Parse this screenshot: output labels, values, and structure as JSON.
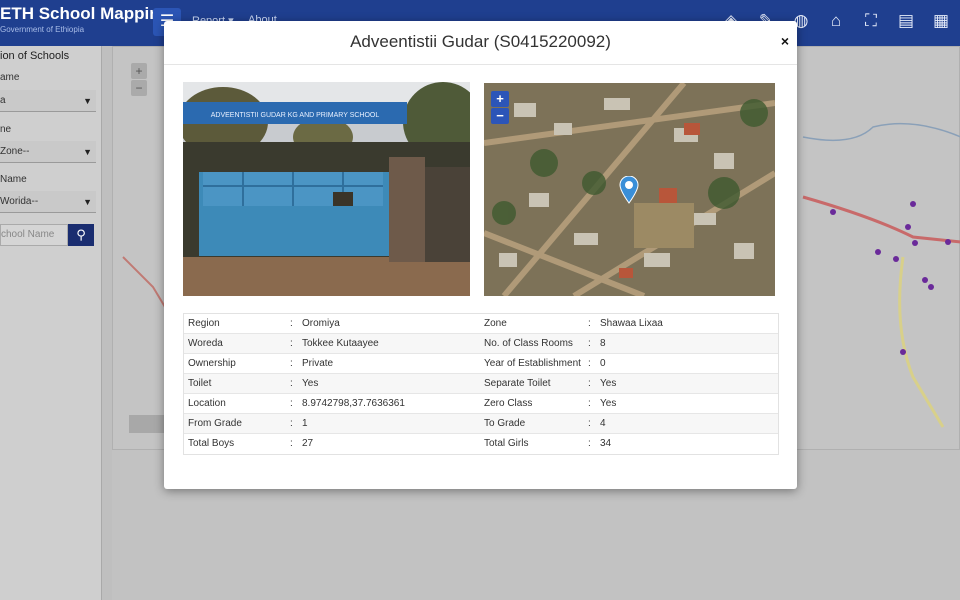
{
  "app": {
    "brand_title": "ETH School Mapping",
    "brand_subtitle": "Government of Ethiopia",
    "menu_icon": "hamburger-icon",
    "nav_links": [
      "Report ▾",
      "About"
    ],
    "nav_icons": [
      "layers-icon",
      "pencil-icon",
      "globe-icon",
      "home-icon",
      "fullscreen-icon",
      "map-icon",
      "layers-alt-icon"
    ]
  },
  "sidebar": {
    "title": "ion of Schools",
    "region_label": "ame",
    "region_value": "a",
    "zone_label": "ne",
    "zone_value": " Zone--",
    "woreda_label": "Name",
    "woreda_value": " Worida--",
    "search_placeholder": "chool Name"
  },
  "modal": {
    "title": "Adveentistii Gudar (S0415220092)",
    "close_label": "×",
    "photo_sign_text": "ADVEENTISTII GUDAR KG AND PRIMARY SCHOOL",
    "map_zoom_in": "+",
    "map_zoom_out": "−",
    "map_marker_icon": "map-marker-icon",
    "rows": [
      {
        "l1": "Region",
        "v1": "Oromiya",
        "l2": "Zone",
        "v2": "Shawaa Lixaa"
      },
      {
        "l1": "Woreda",
        "v1": "Tokkee Kutaayee",
        "l2": "No. of Class Rooms",
        "v2": "8"
      },
      {
        "l1": "Ownership",
        "v1": "Private",
        "l2": "Year of Establishment",
        "v2": "0"
      },
      {
        "l1": "Toilet",
        "v1": "Yes",
        "l2": "Separate Toilet",
        "v2": "Yes"
      },
      {
        "l1": "Location",
        "v1": "8.9742798,37.7636361",
        "l2": "Zero Class",
        "v2": "Yes"
      },
      {
        "l1": "From Grade",
        "v1": "1",
        "l2": "To Grade",
        "v2": "4"
      },
      {
        "l1": "Total Boys",
        "v1": "27",
        "l2": "Total Girls",
        "v2": "34"
      }
    ],
    "colon": ":"
  },
  "colors": {
    "navbar": "#1f3f8f",
    "accent": "#2c55b8",
    "marker": "#6a2a9a"
  }
}
